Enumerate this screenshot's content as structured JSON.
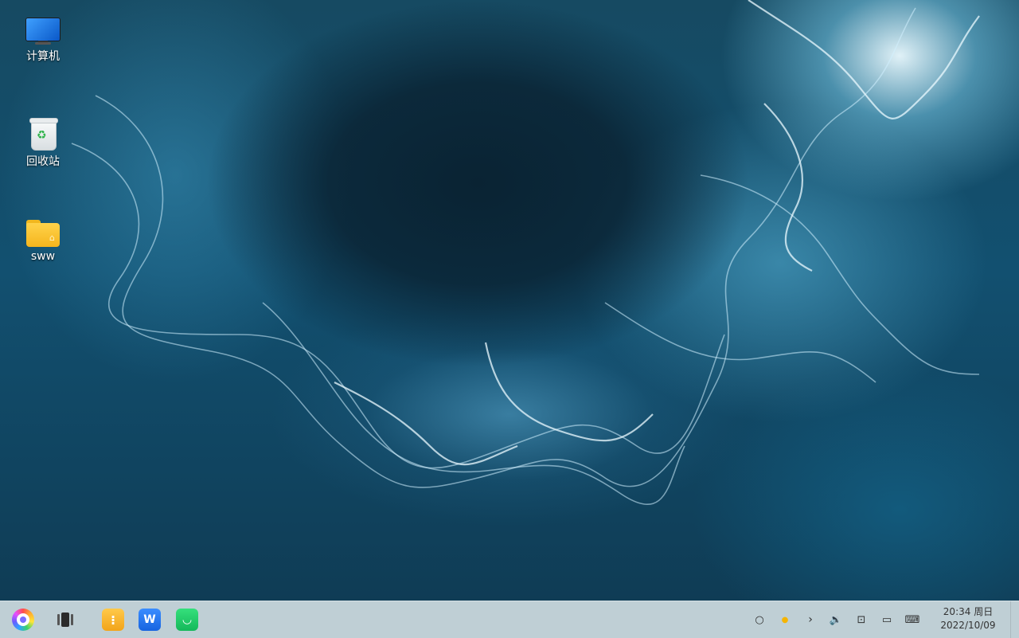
{
  "desktop": {
    "icons": [
      {
        "label": "计算机",
        "icon": "computer-icon"
      },
      {
        "label": "回收站",
        "icon": "trash-icon"
      },
      {
        "label": "sww",
        "icon": "home-folder-icon"
      }
    ]
  },
  "taskbar": {
    "launcher": {
      "icon": "launcher-icon"
    },
    "multitask": {
      "icon": "multitask-view-icon"
    },
    "apps": [
      {
        "name": "yellow-app",
        "glyph": "⁝",
        "color": "#f2a41a"
      },
      {
        "name": "wps-office",
        "glyph": "W",
        "color": "#1764e0"
      },
      {
        "name": "green-app",
        "glyph": "◡",
        "color": "#15b85a"
      }
    ],
    "tray": {
      "search": "○",
      "sun": "●",
      "arrow": "›",
      "volume": "🔉",
      "network": "⊡",
      "chat": "▭",
      "keyboard": "⌨"
    },
    "clock": {
      "time": "20:34 周日",
      "date": "2022/10/09"
    }
  }
}
